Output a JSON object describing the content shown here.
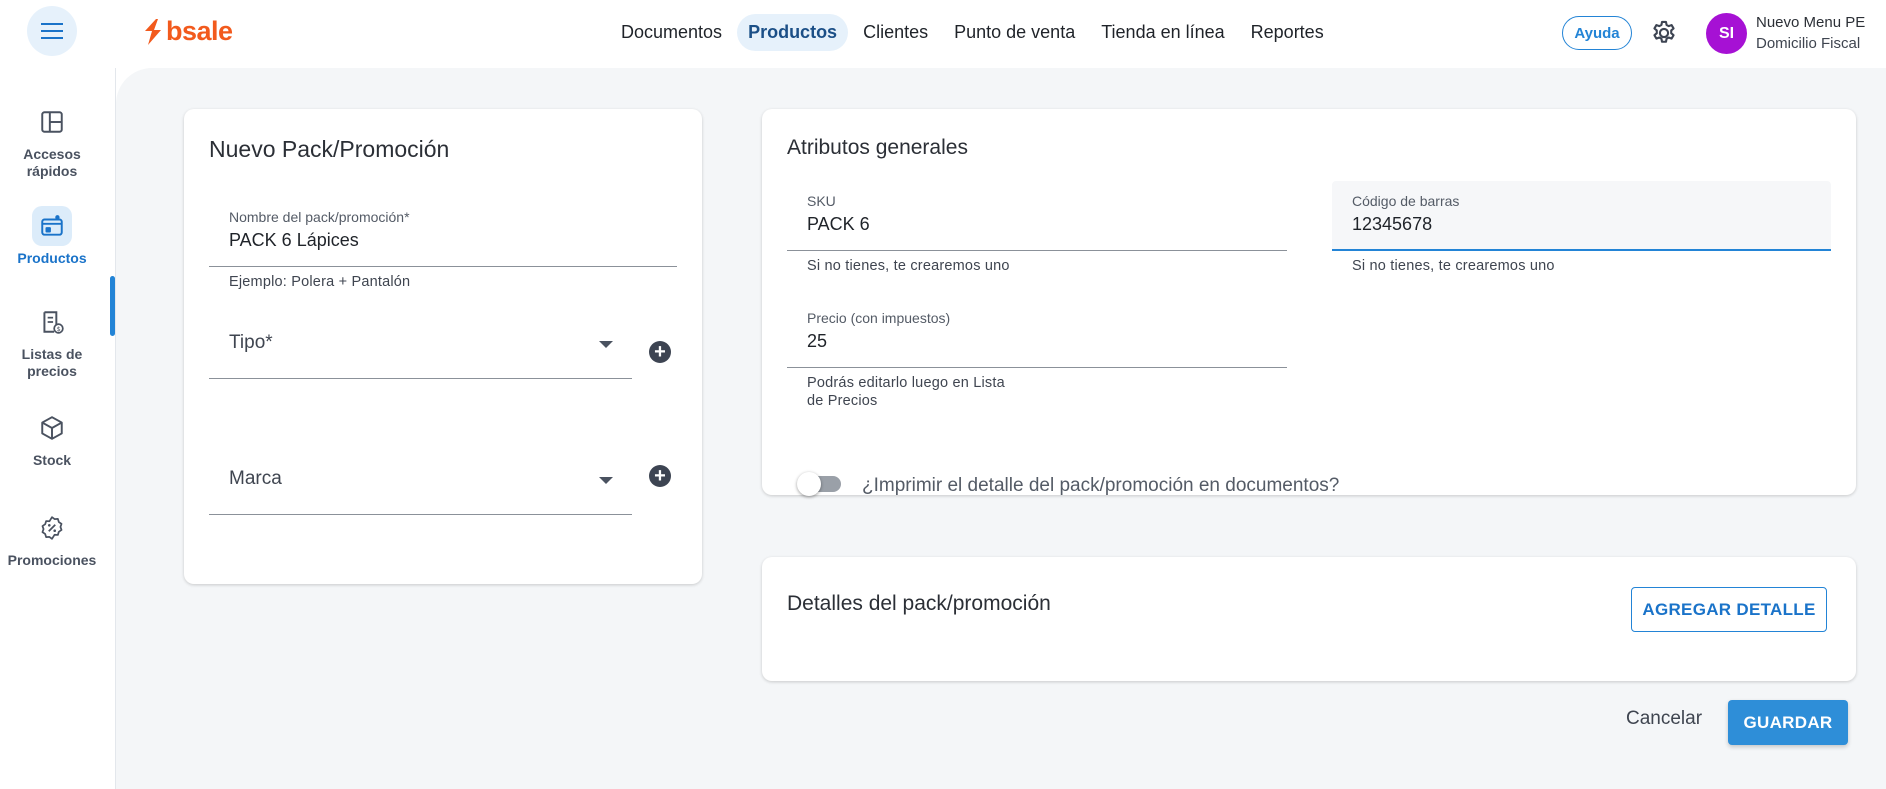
{
  "app": {
    "logo_text": "bsale",
    "brand_color": "#f25a1d",
    "accent_color": "#2384d6"
  },
  "nav": {
    "items": [
      {
        "label": "Documentos",
        "active": false
      },
      {
        "label": "Productos",
        "active": true
      },
      {
        "label": "Clientes",
        "active": false
      },
      {
        "label": "Punto de venta",
        "active": false
      },
      {
        "label": "Tienda en línea",
        "active": false
      },
      {
        "label": "Reportes",
        "active": false
      }
    ]
  },
  "header": {
    "help_label": "Ayuda",
    "settings_icon": "gear-icon",
    "avatar_initials": "SI",
    "user_name": "Nuevo Menu PE",
    "user_subtitle": "Domicilio Fiscal"
  },
  "sidebar": {
    "items": [
      {
        "label": "Accesos rápidos",
        "icon": "dashboard-icon"
      },
      {
        "label": "Productos",
        "icon": "products-icon",
        "active": true
      },
      {
        "label": "Listas de precios",
        "icon": "price-list-icon"
      },
      {
        "label": "Stock",
        "icon": "box-icon"
      },
      {
        "label": "Promociones",
        "icon": "discount-icon"
      }
    ]
  },
  "pack_form": {
    "title": "Nuevo Pack/Promoción",
    "name_label": "Nombre del pack/promoción*",
    "name_value": "PACK 6 Lápices",
    "name_hint": "Ejemplo: Polera + Pantalón",
    "type_placeholder": "Tipo*",
    "brand_placeholder": "Marca"
  },
  "attributes": {
    "title": "Atributos generales",
    "sku_label": "SKU",
    "sku_value": "PACK 6",
    "sku_hint": "Si no tienes, te crearemos uno",
    "barcode_label": "Código de barras",
    "barcode_value": "12345678",
    "barcode_hint": "Si no tienes, te crearemos uno",
    "price_label": "Precio (con impuestos)",
    "price_value": "25",
    "price_hint_line1": "Podrás editarlo luego en Lista",
    "price_hint_line2": "de Precios",
    "print_toggle_label": "¿Imprimir el detalle del pack/promoción en documentos?",
    "print_toggle_on": false
  },
  "details": {
    "title": "Detalles del pack/promoción",
    "add_button": "AGREGAR DETALLE"
  },
  "actions": {
    "cancel": "Cancelar",
    "save": "GUARDAR"
  }
}
